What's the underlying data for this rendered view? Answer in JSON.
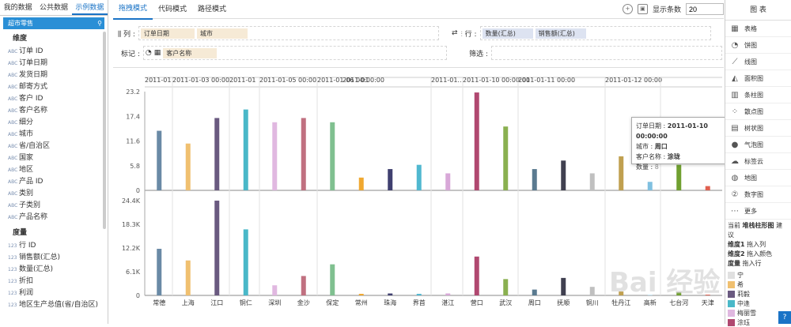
{
  "left": {
    "tabs": [
      "我的数据",
      "公共数据",
      "示例数据"
    ],
    "dataset": "超市零售",
    "dim_title": "维度",
    "measure_title": "度量",
    "dims": [
      "订单 ID",
      "订单日期",
      "发货日期",
      "邮寄方式",
      "客户 ID",
      "客户名称",
      "细分",
      "城市",
      "省/自治区",
      "国家",
      "地区",
      "产品 ID",
      "类别",
      "子类别",
      "产品名称"
    ],
    "measures": [
      "行 ID",
      "销售额(汇总)",
      "数量(汇总)",
      "折扣",
      "利润",
      "地区生产总值(省/自治区)"
    ]
  },
  "main": {
    "tabs": [
      "拖拽模式",
      "代码模式",
      "路径模式"
    ],
    "show_count_label": "显示条数",
    "show_count": "20",
    "col_label": "列 :",
    "col_fields": [
      "订单日期",
      "城市"
    ],
    "row_label": "行 :",
    "row_fields": [
      "数量(汇总)",
      "销售额(汇总)"
    ],
    "mark_label": "标记 :",
    "mark_fields": [
      "客户名称"
    ],
    "filter_label": "筛选 :"
  },
  "chart_data": {
    "type": "bar",
    "categories": [
      "常德",
      "上海",
      "江口",
      "铜仁",
      "深圳",
      "金沙",
      "保定",
      "常州",
      "珠海",
      "界首",
      "湛江",
      "营口",
      "武汉",
      "周口",
      "抚顺",
      "铜川",
      "牡丹江",
      "高新",
      "七台河",
      "天津"
    ],
    "header_dates": [
      "2011-01",
      "2011-01-03 00:00..",
      "2011-01",
      "2011-01-05 00:00",
      "2011-01-06 00:00:00",
      "2011-01",
      "2011-01..",
      "2011-01-10 00:00:00",
      "2011-01-11 00:00",
      "2011-01-12 00:00"
    ],
    "top_ticks": [
      "23.2",
      "17.4",
      "11.6",
      "5.8",
      "0"
    ],
    "bottom_ticks": [
      "24.4K",
      "18.3K",
      "12.2K",
      "6.1K",
      "0"
    ],
    "ylim_top": [
      0,
      23.2
    ],
    "ylim_bottom": [
      0,
      24400
    ],
    "series": [
      {
        "name": "数量(汇总)",
        "values": [
          14,
          11,
          17,
          19,
          16,
          17,
          16,
          3,
          5,
          6,
          4,
          23,
          15,
          5,
          7,
          4,
          8,
          2,
          6,
          1
        ]
      },
      {
        "name": "销售额(汇总)",
        "values": [
          12000,
          9000,
          24400,
          17000,
          2600,
          5000,
          8000,
          400,
          500,
          400,
          500,
          10000,
          4200,
          1500,
          4500,
          2200,
          1000,
          100,
          800,
          200
        ]
      }
    ],
    "colors": [
      "#6a8aa6",
      "#f0c070",
      "#6a5a80",
      "#4ab8c8",
      "#e0b8e0",
      "#c07080",
      "#80c090",
      "#f0a830",
      "#404070",
      "#50b8d0",
      "#d8a8d8",
      "#b04870",
      "#8ab050",
      "#5a7a90",
      "#404050",
      "#c0c0c0",
      "#c0a050",
      "#80c0e0",
      "#70a030",
      "#e06050"
    ]
  },
  "tooltip": {
    "l1": "订单日期 :",
    "v1": "2011-01-10 00:00:00",
    "l2": "城市 :",
    "v2": "周口",
    "l3": "客户名称 :",
    "v3": "涂珑",
    "l4": "数量 :",
    "v4": "8"
  },
  "right": {
    "title": "图 表",
    "types": [
      "表格",
      "饼图",
      "线图",
      "面积图",
      "条柱图",
      "散点图",
      "树状图",
      "气泡图",
      "标签云",
      "地图",
      "数字图",
      "更多"
    ],
    "hint": {
      "cur": "当前",
      "cur_type": "堆栈柱形图",
      "suggest": "建议",
      "d1": "维度1",
      "d1t": "拖入列",
      "d2": "维度2",
      "d2t": "拖入颜色",
      "m": "度量",
      "mt": "拖入行"
    },
    "legend": [
      "宁",
      "希",
      "莉毅",
      "中逢",
      "梅丽雪",
      "涂珏"
    ]
  },
  "watermark": "Bai 经验"
}
